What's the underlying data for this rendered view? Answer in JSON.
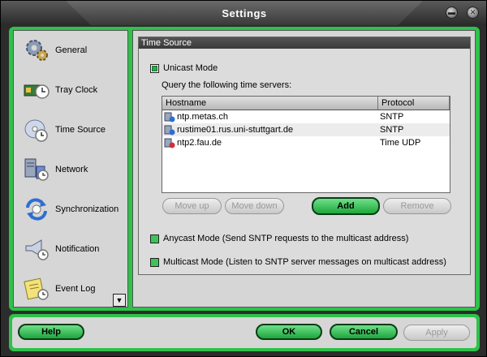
{
  "window": {
    "title": "Settings"
  },
  "sidebar": {
    "items": [
      {
        "label": "General",
        "icon": "gear-icon"
      },
      {
        "label": "Tray Clock",
        "icon": "tray-clock-icon"
      },
      {
        "label": "Time Source",
        "icon": "clock-disc-icon"
      },
      {
        "label": "Network",
        "icon": "network-server-icon"
      },
      {
        "label": "Synchronization",
        "icon": "sync-arrows-icon"
      },
      {
        "label": "Notification",
        "icon": "megaphone-icon"
      },
      {
        "label": "Event Log",
        "icon": "event-log-icon"
      }
    ],
    "scroll_down_icon": "triangle-down-icon"
  },
  "time_source": {
    "group_title": "Time Source",
    "unicast_label": "Unicast Mode",
    "unicast_checked": true,
    "query_label": "Query the following time servers:",
    "columns": [
      "Hostname",
      "Protocol"
    ],
    "servers": [
      {
        "hostname": "ntp.metas.ch",
        "protocol": "SNTP"
      },
      {
        "hostname": "rustime01.rus.uni-stuttgart.de",
        "protocol": "SNTP"
      },
      {
        "hostname": "ntp2.fau.de",
        "protocol": "Time UDP"
      }
    ],
    "buttons": {
      "move_up": "Move up",
      "move_down": "Move down",
      "add": "Add",
      "remove": "Remove"
    },
    "anycast_label": "Anycast Mode (Send SNTP requests to the multicast address)",
    "anycast_checked": false,
    "multicast_label": "Multicast Mode (Listen to SNTP server messages on multicast address)",
    "multicast_checked": false
  },
  "footer": {
    "help": "Help",
    "ok": "OK",
    "cancel": "Cancel",
    "apply": "Apply"
  },
  "colors": {
    "accent": "#2fc14a",
    "title_bar": "#3a3a3a",
    "panel": "#d6d6d6"
  }
}
